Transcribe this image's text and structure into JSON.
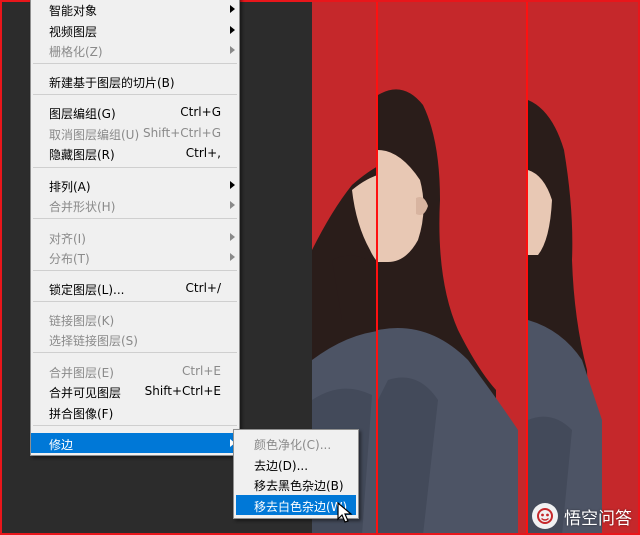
{
  "colors": {
    "photo_background": "#c5282b",
    "guide_line": "#ff1010",
    "menu_background": "#f0f0f0",
    "highlight": "#0078d7",
    "disabled_text": "#8a8a8a"
  },
  "menu": {
    "items": [
      {
        "label": "智能对象",
        "shortcut": "",
        "submenu": true,
        "disabled": false
      },
      {
        "label": "视频图层",
        "shortcut": "",
        "submenu": true,
        "disabled": false
      },
      {
        "label": "栅格化(Z)",
        "shortcut": "",
        "submenu": true,
        "disabled": true
      },
      {
        "label": "新建基于图层的切片(B)",
        "shortcut": "",
        "submenu": false,
        "disabled": false
      },
      {
        "label": "图层编组(G)",
        "shortcut": "Ctrl+G",
        "submenu": false,
        "disabled": false
      },
      {
        "label": "取消图层编组(U)",
        "shortcut": "Shift+Ctrl+G",
        "submenu": false,
        "disabled": true
      },
      {
        "label": "隐藏图层(R)",
        "shortcut": "Ctrl+,",
        "submenu": false,
        "disabled": false
      },
      {
        "label": "排列(A)",
        "shortcut": "",
        "submenu": true,
        "disabled": false
      },
      {
        "label": "合并形状(H)",
        "shortcut": "",
        "submenu": true,
        "disabled": true
      },
      {
        "label": "对齐(I)",
        "shortcut": "",
        "submenu": true,
        "disabled": true
      },
      {
        "label": "分布(T)",
        "shortcut": "",
        "submenu": true,
        "disabled": true
      },
      {
        "label": "锁定图层(L)...",
        "shortcut": "Ctrl+/",
        "submenu": false,
        "disabled": false
      },
      {
        "label": "链接图层(K)",
        "shortcut": "",
        "submenu": false,
        "disabled": true
      },
      {
        "label": "选择链接图层(S)",
        "shortcut": "",
        "submenu": false,
        "disabled": true
      },
      {
        "label": "合并图层(E)",
        "shortcut": "Ctrl+E",
        "submenu": false,
        "disabled": true
      },
      {
        "label": "合并可见图层",
        "shortcut": "Shift+Ctrl+E",
        "submenu": false,
        "disabled": false
      },
      {
        "label": "拼合图像(F)",
        "shortcut": "",
        "submenu": false,
        "disabled": false
      },
      {
        "label": "修边",
        "shortcut": "",
        "submenu": true,
        "disabled": false,
        "highlighted": true
      }
    ]
  },
  "submenu": {
    "items": [
      {
        "label": "颜色净化(C)...",
        "disabled": true
      },
      {
        "label": "去边(D)...",
        "disabled": false
      },
      {
        "label": "移去黑色杂边(B)",
        "disabled": false
      },
      {
        "label": "移去白色杂边(W)",
        "disabled": false,
        "highlighted": true
      }
    ]
  },
  "watermark": {
    "text": "悟空问答",
    "icon": "wukong-logo-icon"
  }
}
